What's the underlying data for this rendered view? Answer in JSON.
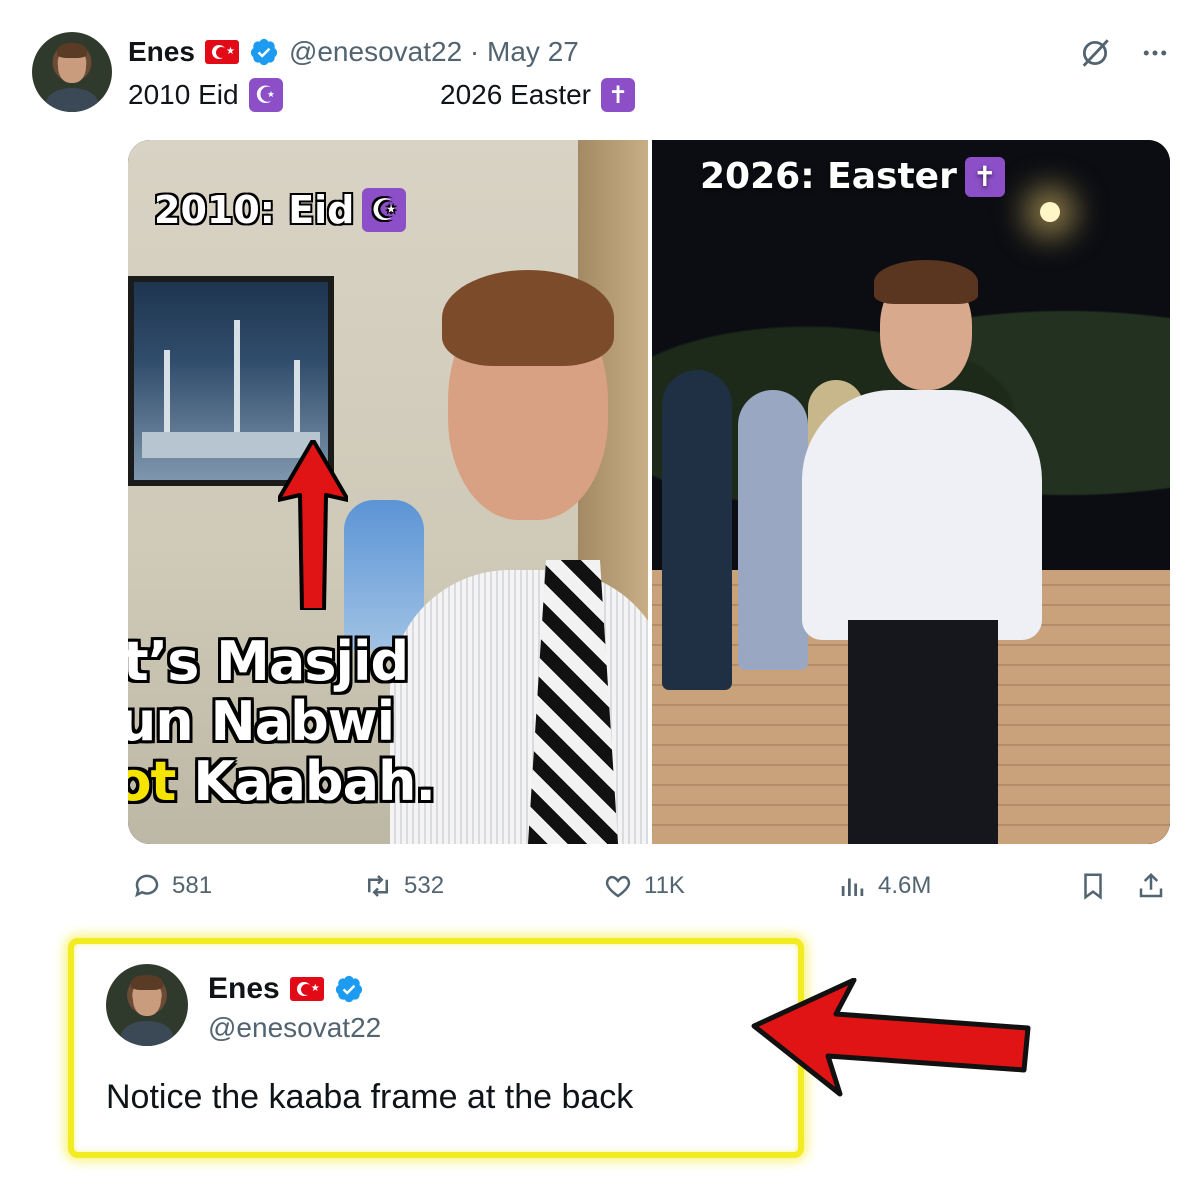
{
  "tweet": {
    "author_name": "Enes",
    "handle_date": "@enesovat22 · May 27",
    "text_part1": "2010 Eid",
    "emoji1": "☪",
    "text_part2": "2026 Easter",
    "emoji2": "✝"
  },
  "media": {
    "left_caption": "2010: Eid",
    "left_caption_emoji": "☪",
    "right_caption": "2026: Easter",
    "right_caption_emoji": "✝",
    "overlay_line1": "It’s Masjid",
    "overlay_line2": "un Nabwi",
    "overlay_line3_highlight": "not",
    "overlay_line3_rest": "Kaabah."
  },
  "actions": {
    "replies": "581",
    "retweets": "532",
    "likes": "11K",
    "views": "4.6M"
  },
  "reply": {
    "author_name": "Enes",
    "handle": "@enesovat22",
    "text": "Notice the kaaba frame at the back"
  },
  "colors": {
    "verified": "#1d9bf0",
    "highlight_border": "#f3ec23",
    "arrow_red": "#e01414",
    "overlay_highlight": "#f5e400"
  },
  "icons": [
    "more-icon",
    "grok-icon",
    "reply-icon",
    "retweet-icon",
    "like-icon",
    "views-icon",
    "bookmark-icon",
    "share-icon",
    "verified-icon"
  ]
}
